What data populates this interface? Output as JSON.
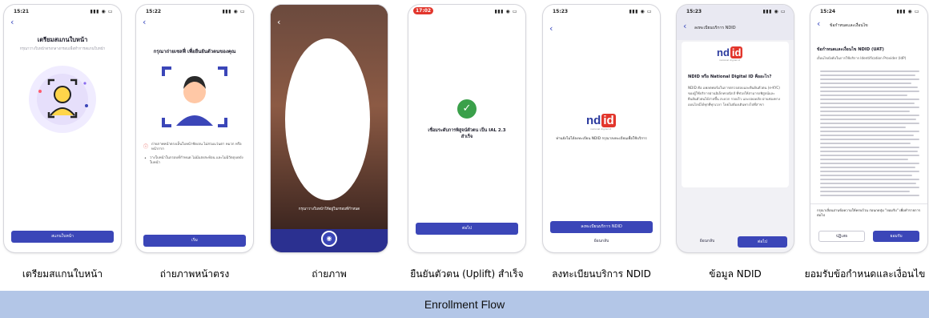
{
  "footer": {
    "title": "Enrollment Flow"
  },
  "screens": [
    {
      "time": "15:21",
      "title": "เตรียมสแกนใบหน้า",
      "subtitle": "กรุณาวางใบหน้าตรงกลางกรอบเพื่อทำการสแกนใบหน้า",
      "button": "สแกนใบหน้า",
      "caption": "เตรียมสแกนใบหน้า"
    },
    {
      "time": "15:22",
      "title": "กรุณาถ่ายเซลฟี่ เพื่อยืนยันตัวตนของคุณ",
      "tips": [
        "ถ่ายภาพหน้าตรงเห็นใบหน้าชัดเจน ไม่สวมแว่นตา หมวก หรือหน้ากาก",
        "วางใบหน้าในกรอบที่กำหนด ไม่มีแสงสะท้อน และไม่มีวัตถุบดบังใบหน้า"
      ],
      "button": "เริ่ม",
      "caption": "ถ่ายภาพหน้าตรง"
    },
    {
      "hint": "กรุณาวางใบหน้าให้อยู่ในกรอบที่กำหนด",
      "caption": "ถ่ายภาพ"
    },
    {
      "time": "17:02",
      "message": "เชื่อมระดับการพิสูจน์ตัวตน เป็น IAL 2.3 สำเร็จ",
      "button": "ต่อไป",
      "caption": "ยืนยันตัวตน (Uplift) สำเร็จ"
    },
    {
      "time": "15:23",
      "logo_nd": "nd",
      "logo_id": "id",
      "logo_tag": "national digital id",
      "text": "ท่านยังไม่ได้ลงทะเบียน NDID กรุณาลงทะเบียนเพื่อใช้บริการ",
      "primary_button": "ลงทะเบียนบริการ NDID",
      "secondary_button": "ย้อนกลับ",
      "caption": "ลงทะเบียนบริการ NDID"
    },
    {
      "time": "15:23",
      "header": "ลงทะเบียนบริการ NDID",
      "logo_nd": "nd",
      "logo_id": "id",
      "logo_tag": "national digital id",
      "heading": "NDID หรือ National Digital ID คืออะไร?",
      "body": "NDID คือ แพลตฟอร์มในการตรวจสอบและยืนยันตัวตน (e-KYC) ของผู้ใช้บริการผ่านอิเล็กทรอนิกส์ ที่ช่วยให้สามารถพิสูจน์และยืนยันตัวตนได้ง่ายขึ้น สะดวก รวดเร็ว และปลอดภัย ผ่านช่องทางออนไลน์ได้ทุกที่ทุกเวลา โดยไม่ต้องเดินทางไปที่สาขา",
      "back_button": "ย้อนกลับ",
      "next_button": "ต่อไป",
      "caption": "ข้อมูล NDID"
    },
    {
      "time": "15:24",
      "header": "ข้อกำหนดและเงื่อนไข",
      "heading": "ข้อกำหนดและเงื่อนไข NDID (UAT)",
      "intro": "เงื่อนไขบังคับในการใช้บริการ Identification Provider (IdP)",
      "consent": "กรุณาเลื่อนอ่านข้อความให้ครบถ้วน ก่อนกดปุ่ม \"ยอมรับ\" เพื่อทำรายการต่อไป",
      "reject_button": "ปฏิเสธ",
      "accept_button": "ยอมรับ",
      "caption": "ยอมรับข้อกำหนดและเงื่อนไข"
    }
  ]
}
